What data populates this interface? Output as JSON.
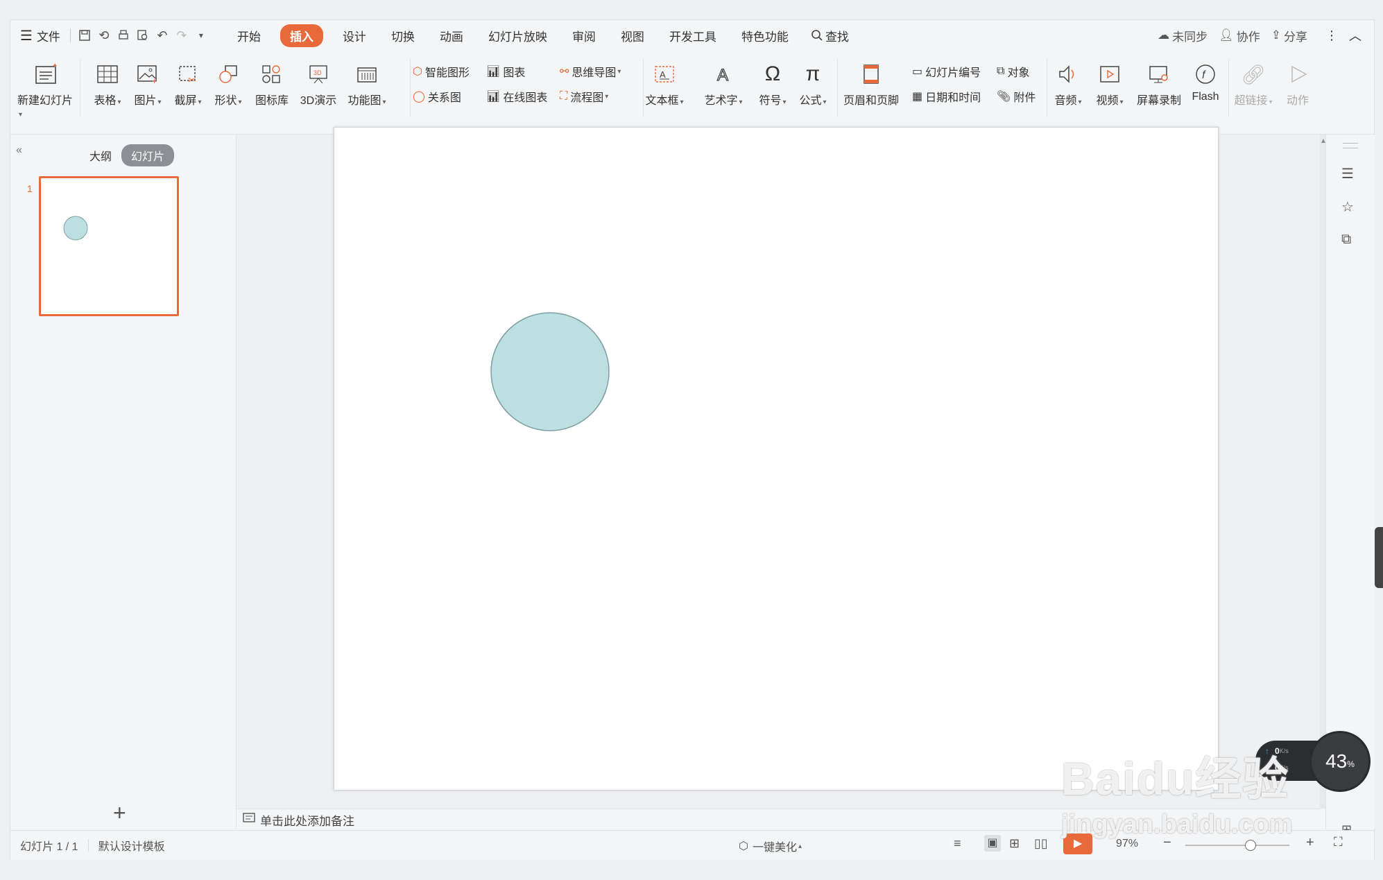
{
  "menubar": {
    "file": "文件",
    "tabs": [
      "开始",
      "插入",
      "设计",
      "切换",
      "动画",
      "幻灯片放映",
      "审阅",
      "视图",
      "开发工具",
      "特色功能"
    ],
    "active_tab": "插入",
    "search": "查找",
    "unsync": "未同步",
    "collab": "协作",
    "share": "分享"
  },
  "ribbon": {
    "new_slide": "新建幻灯片",
    "table": "表格",
    "picture": "图片",
    "screenshot": "截屏",
    "shape": "形状",
    "icon_lib": "图标库",
    "demo3d": "3D演示",
    "func_chart": "功能图",
    "smart_shape": "智能图形",
    "chart": "图表",
    "mind_map": "思维导图",
    "relation": "关系图",
    "online_chart": "在线图表",
    "flowchart": "流程图",
    "textbox": "文本框",
    "wordart": "艺术字",
    "symbol": "符号",
    "formula": "公式",
    "header_footer": "页眉和页脚",
    "slide_number": "幻灯片编号",
    "object": "对象",
    "datetime": "日期和时间",
    "attachment": "附件",
    "audio": "音频",
    "video": "视频",
    "screen_record": "屏幕录制",
    "flash": "Flash",
    "hyperlink": "超链接",
    "action": "动作"
  },
  "panel": {
    "outline": "大纲",
    "slides": "幻灯片",
    "slide_num": "1",
    "add": "+"
  },
  "notes": {
    "placeholder": "单击此处添加备注"
  },
  "status": {
    "slide_info": "幻灯片 1 / 1",
    "template": "默认设计模板",
    "beautify": "一键美化",
    "zoom": "97%"
  },
  "overlay": {
    "up_speed": "0",
    "down_speed": "0",
    "speed_unit": "K/s",
    "percent": "43",
    "percent_unit": "%",
    "watermark": "Baidu经验",
    "watermark_url": "jingyan.baidu.com"
  },
  "colors": {
    "accent": "#e8693a",
    "circle_fill": "#bcdfe2",
    "circle_stroke": "#7e9ea3"
  }
}
